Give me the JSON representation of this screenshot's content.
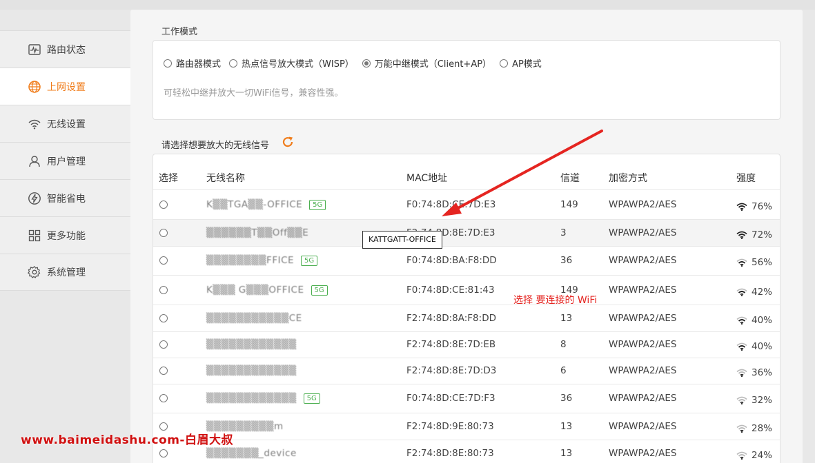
{
  "sidebar": {
    "items": [
      {
        "label": "路由状态",
        "icon": "pulse-chart-icon"
      },
      {
        "label": "上网设置",
        "icon": "globe-icon",
        "active": true
      },
      {
        "label": "无线设置",
        "icon": "wifi-icon"
      },
      {
        "label": "用户管理",
        "icon": "user-icon"
      },
      {
        "label": "智能省电",
        "icon": "lightning-icon"
      },
      {
        "label": "更多功能",
        "icon": "grid-icon"
      },
      {
        "label": "系统管理",
        "icon": "gear-icon"
      }
    ]
  },
  "work_mode": {
    "title": "工作模式",
    "options": [
      "路由器模式",
      "热点信号放大模式（WISP）",
      "万能中继模式（Client+AP）",
      "AP模式"
    ],
    "selected_index": 2,
    "hint": "可轻松中继并放大一切WiFi信号，兼容性强。"
  },
  "wifi_list": {
    "title": "请选择想要放大的无线信号",
    "columns": [
      "选择",
      "无线名称",
      "MAC地址",
      "信道",
      "加密方式",
      "强度"
    ],
    "badge_label": "5G",
    "rows": [
      {
        "name": "K▒▒TGA▒▒-OFFICE",
        "is5g": true,
        "mac": "F0:74:8D:CE:7D:E3",
        "channel": "149",
        "enc": "WPAWPA2/AES",
        "strength": "76%"
      },
      {
        "name": "▒▒▒▒▒▒T▒▒Off▒▒E",
        "is5g": false,
        "mac": "F2:74:8D:8E:7D:E3",
        "channel": "3",
        "enc": "WPAWPA2/AES",
        "strength": "72%"
      },
      {
        "name": "▒▒▒▒▒▒▒▒FFICE",
        "is5g": true,
        "mac": "F0:74:8D:BA:F8:DD",
        "channel": "36",
        "enc": "WPAWPA2/AES",
        "strength": "56%"
      },
      {
        "name": "K▒▒▒ G▒▒▒OFFICE",
        "is5g": true,
        "mac": "F0:74:8D:CE:81:43",
        "channel": "149",
        "enc": "WPAWPA2/AES",
        "strength": "42%"
      },
      {
        "name": "▒▒▒▒▒▒▒▒▒▒▒CE",
        "is5g": false,
        "mac": "F2:74:8D:8A:F8:DD",
        "channel": "13",
        "enc": "WPAWPA2/AES",
        "strength": "40%"
      },
      {
        "name": "▒▒▒▒▒▒▒▒▒▒▒▒",
        "is5g": false,
        "mac": "F2:74:8D:8E:7D:EB",
        "channel": "8",
        "enc": "WPAWPA2/AES",
        "strength": "40%"
      },
      {
        "name": "▒▒▒▒▒▒▒▒▒▒▒▒",
        "is5g": false,
        "mac": "F2:74:8D:8E:7D:D3",
        "channel": "6",
        "enc": "WPAWPA2/AES",
        "strength": "36%"
      },
      {
        "name": "▒▒▒▒▒▒▒▒▒▒▒▒",
        "is5g": true,
        "mac": "F0:74:8D:CE:7D:F3",
        "channel": "36",
        "enc": "WPAWPA2/AES",
        "strength": "32%"
      },
      {
        "name": "▒▒▒▒▒▒▒▒▒m",
        "is5g": false,
        "mac": "F2:74:8D:9E:80:73",
        "channel": "13",
        "enc": "WPAWPA2/AES",
        "strength": "28%"
      },
      {
        "name": "▒▒▒▒▒▒▒_device",
        "is5g": false,
        "mac": "F2:74:8D:8E:80:73",
        "channel": "13",
        "enc": "WPAWPA2/AES",
        "strength": "24%"
      }
    ]
  },
  "tooltip": "KATTGATT-OFFICE",
  "annotation": "选择 要连接的 WiFi",
  "watermark": "www.baimeidashu.com-白眉大叔",
  "colors": {
    "accent": "#f07c1a",
    "annotation": "#e52521",
    "badge": "#4caf50"
  }
}
